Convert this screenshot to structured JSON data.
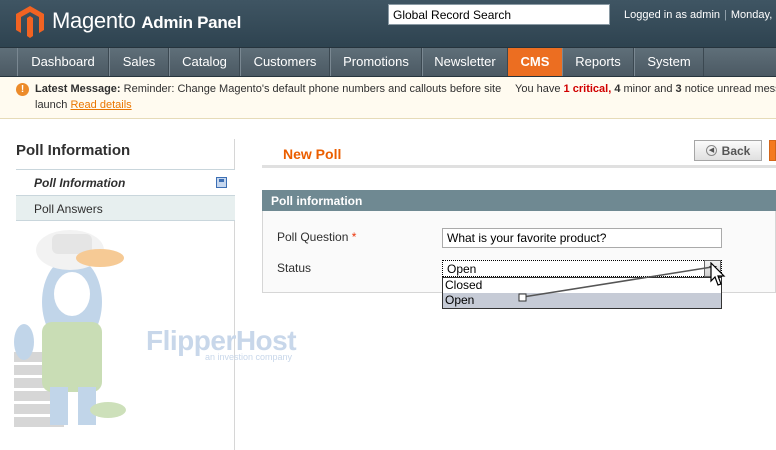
{
  "header": {
    "app_title": "Magento",
    "app_subtitle": "Admin Panel",
    "search_value": "Global Record Search",
    "logged_in_text": "Logged in as admin",
    "date_text": "Monday,"
  },
  "nav": {
    "items": [
      {
        "label": "Dashboard",
        "active": false
      },
      {
        "label": "Sales",
        "active": false
      },
      {
        "label": "Catalog",
        "active": false
      },
      {
        "label": "Customers",
        "active": false
      },
      {
        "label": "Promotions",
        "active": false
      },
      {
        "label": "Newsletter",
        "active": false
      },
      {
        "label": "CMS",
        "active": true
      },
      {
        "label": "Reports",
        "active": false
      },
      {
        "label": "System",
        "active": false
      }
    ]
  },
  "message": {
    "icon": "!",
    "title": "Latest Message:",
    "text": "Reminder: Change Magento's default phone numbers and callouts before site",
    "text_line2": "launch",
    "read_details": "Read details",
    "notice_prefix": "You have",
    "critical_count": "1",
    "critical_label": "critical,",
    "minor_count": "4",
    "minor_label": "minor and",
    "notice_count": "3",
    "notice_label": "notice unread messa"
  },
  "sidebar": {
    "title": "Poll Information",
    "tabs": [
      {
        "label": "Poll Information",
        "active": true
      },
      {
        "label": "Poll Answers",
        "active": false
      }
    ]
  },
  "watermark": {
    "brand": "FlipperHost",
    "tagline": "an investion company"
  },
  "main": {
    "page_title": "New Poll",
    "back_label": "Back",
    "fieldset_title": "Poll information",
    "question_label": "Poll Question",
    "required_mark": "*",
    "question_value": "What is your favorite product?",
    "status_label": "Status",
    "status_value": "Open",
    "status_options": [
      "Closed",
      "Open"
    ],
    "status_selected": "Open"
  },
  "colors": {
    "accent": "#ec6e21",
    "header_bg": "#3f5563",
    "nav_bg": "#5f6f79",
    "fieldset_head": "#6f8992",
    "page_title": "#eb5e00"
  }
}
